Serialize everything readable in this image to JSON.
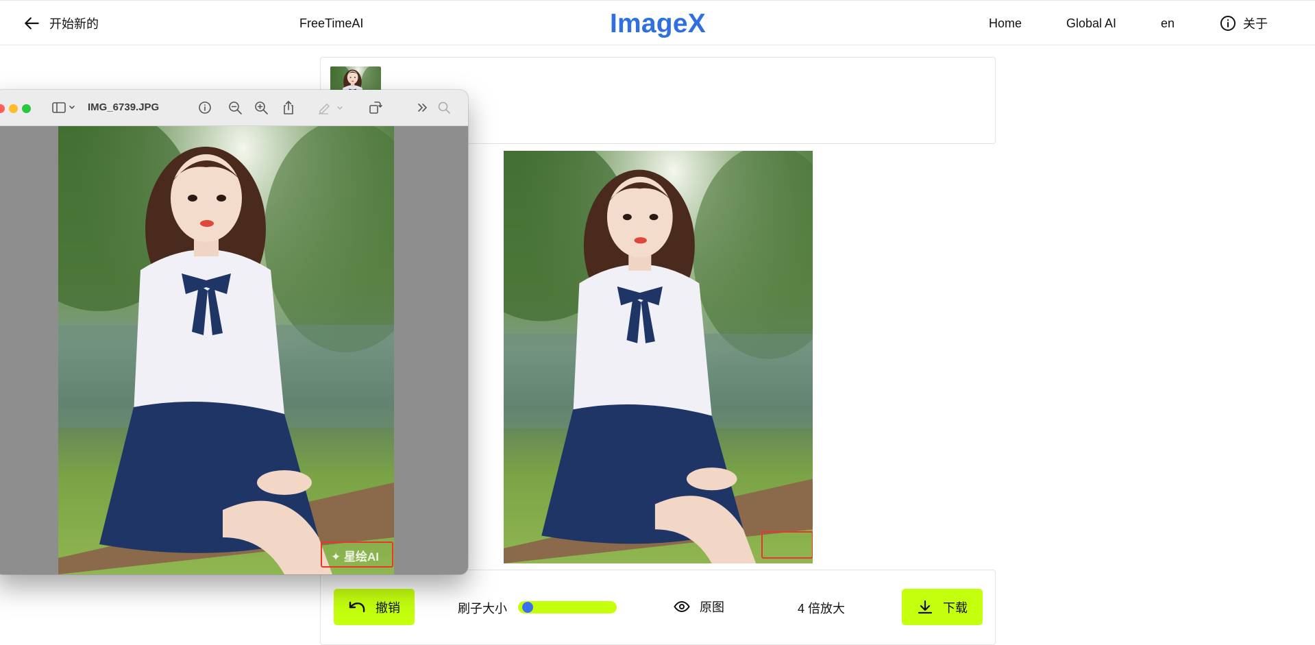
{
  "nav": {
    "back_label": "开始新的",
    "brand_left": "FreeTimeAI",
    "logo": "ImageX",
    "home": "Home",
    "global_ai": "Global AI",
    "lang": "en",
    "about": "关于"
  },
  "preview_window": {
    "title": "IMG_6739.JPG",
    "watermark": "星绘AI"
  },
  "toolbar": {
    "undo_label": "撤销",
    "brush_size_label": "刷子大小",
    "brush_size_value": 0.1,
    "original_label": "原图",
    "upscale_label": "4 倍放大",
    "download_label": "下载"
  },
  "colors": {
    "accent": "#c4ff0e",
    "logo": "#2f6fe0",
    "slider_knob": "#3a6ff0",
    "mark": "#e8362a"
  },
  "icons": [
    "arrow-left-icon",
    "info-icon",
    "undo-icon",
    "eye-icon",
    "download-icon",
    "sidebar-icon",
    "zoom-out-icon",
    "zoom-in-icon",
    "share-icon",
    "markup-icon",
    "rotate-icon",
    "more-icon",
    "search-icon"
  ]
}
